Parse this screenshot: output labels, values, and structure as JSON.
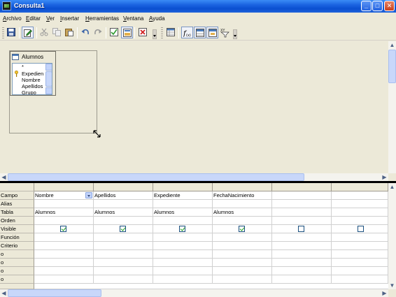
{
  "window": {
    "title": "Consulta1",
    "minimize": "_",
    "maximize": "□",
    "close": "✕"
  },
  "menu": [
    "Archivo",
    "Editar",
    "Ver",
    "Insertar",
    "Herramientas",
    "Ventana",
    "Ayuda"
  ],
  "toolbar": {
    "icons": [
      "save-icon",
      "edit-mode-icon",
      "cut-icon",
      "copy-icon",
      "paste-icon",
      "undo-icon",
      "redo-icon",
      "run-query-icon",
      "clear-query-icon",
      "delete-table-icon",
      "add-table-icon",
      "functions-icon",
      "table-name-icon",
      "alias-icon",
      "distinct-values-icon"
    ],
    "distinct_label": "XY"
  },
  "table_window": {
    "title": "Alumnos",
    "fields": [
      "*",
      "Expedien",
      "Nombre",
      "Apellidos",
      "Grupo"
    ]
  },
  "grid": {
    "row_labels": [
      "Campo",
      "Alias",
      "Tabla",
      "Orden",
      "Visible",
      "Función",
      "Criterio",
      "o",
      "o",
      "o",
      "o"
    ],
    "columns": [
      {
        "campo": "Nombre",
        "tabla": "Alumnos",
        "visible": true,
        "has_dropdown": true
      },
      {
        "campo": "Apellidos",
        "tabla": "Alumnos",
        "visible": true,
        "has_dropdown": false
      },
      {
        "campo": "Expediente",
        "tabla": "Alumnos",
        "visible": true,
        "has_dropdown": false
      },
      {
        "campo": "FechaNacimiento",
        "tabla": "Alumnos",
        "visible": true,
        "has_dropdown": false
      },
      {
        "campo": "",
        "tabla": "",
        "visible": false,
        "has_dropdown": false
      },
      {
        "campo": "",
        "tabla": "",
        "visible": false,
        "has_dropdown": false
      }
    ]
  },
  "colors": {
    "titlebar": "#0a4fd0",
    "background": "#ece9d8",
    "scroll_thumb": "#c8d7fa",
    "check": "#21a121"
  }
}
